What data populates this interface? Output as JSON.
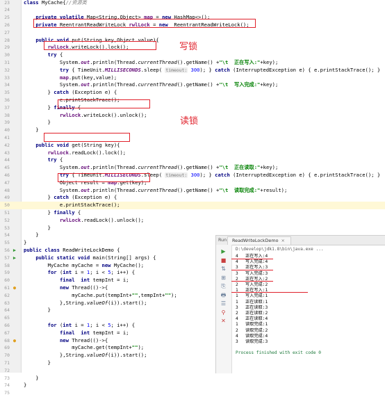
{
  "lines": [
    {
      "n": "23",
      "marker": "",
      "tokens": [
        [
          "kw",
          "class "
        ],
        [
          "",
          "MyCache"
        ],
        [
          "",
          "{"
        ],
        [
          "cmt",
          "//资源类"
        ]
      ]
    },
    {
      "n": "24",
      "marker": "",
      "tokens": []
    },
    {
      "n": "25",
      "marker": "",
      "tokens": [
        [
          "",
          "    "
        ],
        [
          "kw",
          "private volatile "
        ],
        [
          "",
          "Map<String,Object> "
        ],
        [
          "fld",
          "map"
        ],
        [
          "",
          " = "
        ],
        [
          "kw",
          "new "
        ],
        [
          "",
          "HashMap<>();"
        ]
      ]
    },
    {
      "n": "26",
      "marker": "",
      "tokens": [
        [
          "",
          "    "
        ],
        [
          "kw",
          "private "
        ],
        [
          "",
          "ReentrantReadWriteLock "
        ],
        [
          "fld",
          "rwlLock"
        ],
        [
          "",
          " = "
        ],
        [
          "kw",
          "new  "
        ],
        [
          "",
          "ReentrantReadWriteLock();"
        ]
      ]
    },
    {
      "n": "27",
      "marker": "",
      "tokens": []
    },
    {
      "n": "28",
      "marker": "",
      "tokens": [
        [
          "",
          "    "
        ],
        [
          "kw",
          "public void "
        ],
        [
          "",
          "put(String key,Object value){"
        ]
      ]
    },
    {
      "n": "29",
      "marker": "",
      "tokens": [
        [
          "",
          "        "
        ],
        [
          "fld",
          "rwlLock"
        ],
        [
          "",
          ".writeLock().lock();"
        ]
      ]
    },
    {
      "n": "30",
      "marker": "",
      "tokens": [
        [
          "",
          "        "
        ],
        [
          "kw",
          "try "
        ],
        [
          "",
          "{"
        ]
      ]
    },
    {
      "n": "31",
      "marker": "",
      "tokens": [
        [
          "",
          "            System."
        ],
        [
          "sfld",
          "out"
        ],
        [
          "",
          ".println(Thread."
        ],
        [
          "ital",
          "currentThread"
        ],
        [
          "",
          "().getName() +"
        ],
        [
          "str",
          "\"\\t  正在写入:\""
        ],
        [
          "",
          "+key);"
        ]
      ]
    },
    {
      "n": "32",
      "marker": "",
      "tokens": [
        [
          "",
          "            "
        ],
        [
          "kw",
          "try "
        ],
        [
          "",
          "{ TimeUnit."
        ],
        [
          "sfld",
          "MILLISECONDS"
        ],
        [
          "",
          ".sleep( "
        ],
        [
          "hint",
          "timeout:"
        ],
        [
          "num",
          " 300"
        ],
        [
          "",
          "); } "
        ],
        [
          "kw",
          "catch "
        ],
        [
          "",
          "(InterruptedException e) { e.printStackTrace(); }"
        ]
      ]
    },
    {
      "n": "33",
      "marker": "",
      "tokens": [
        [
          "",
          "            "
        ],
        [
          "fld",
          "map"
        ],
        [
          "",
          ".put(key,value);"
        ]
      ]
    },
    {
      "n": "34",
      "marker": "",
      "tokens": [
        [
          "",
          "            System."
        ],
        [
          "sfld",
          "out"
        ],
        [
          "",
          ".println(Thread."
        ],
        [
          "ital",
          "currentThread"
        ],
        [
          "",
          "().getName() +"
        ],
        [
          "str",
          "\"\\t  写入完成:\""
        ],
        [
          "",
          "+key);"
        ]
      ]
    },
    {
      "n": "35",
      "marker": "",
      "tokens": [
        [
          "",
          "        } "
        ],
        [
          "kw",
          "catch "
        ],
        [
          "",
          "(Exception e) {"
        ]
      ]
    },
    {
      "n": "36",
      "marker": "",
      "tokens": [
        [
          "",
          "            e.printStackTrace();"
        ]
      ]
    },
    {
      "n": "37",
      "marker": "",
      "tokens": [
        [
          "",
          "        } "
        ],
        [
          "kw",
          "finally "
        ],
        [
          "",
          "{"
        ]
      ]
    },
    {
      "n": "38",
      "marker": "",
      "tokens": [
        [
          "",
          "            "
        ],
        [
          "fld",
          "rwlLock"
        ],
        [
          "",
          ".writeLock().unlock();"
        ]
      ]
    },
    {
      "n": "39",
      "marker": "",
      "tokens": [
        [
          "",
          "        }"
        ]
      ]
    },
    {
      "n": "40",
      "marker": "",
      "tokens": [
        [
          "",
          "    }"
        ]
      ]
    },
    {
      "n": "41",
      "marker": "",
      "tokens": []
    },
    {
      "n": "42",
      "marker": "",
      "tokens": [
        [
          "",
          "    "
        ],
        [
          "kw",
          "public void "
        ],
        [
          "",
          "get(String key){"
        ]
      ]
    },
    {
      "n": "43",
      "marker": "",
      "tokens": [
        [
          "",
          "        "
        ],
        [
          "fld",
          "rwlLock"
        ],
        [
          "",
          ".readLock().lock();"
        ]
      ]
    },
    {
      "n": "44",
      "marker": "",
      "tokens": [
        [
          "",
          "        "
        ],
        [
          "kw",
          "try "
        ],
        [
          "",
          "{"
        ]
      ]
    },
    {
      "n": "45",
      "marker": "",
      "tokens": [
        [
          "",
          "            System."
        ],
        [
          "sfld",
          "out"
        ],
        [
          "",
          ".println(Thread."
        ],
        [
          "ital",
          "currentThread"
        ],
        [
          "",
          "().getName() +"
        ],
        [
          "str",
          "\"\\t  正在读取:\""
        ],
        [
          "",
          "+key);"
        ]
      ]
    },
    {
      "n": "46",
      "marker": "",
      "tokens": [
        [
          "",
          "            "
        ],
        [
          "kw",
          "try "
        ],
        [
          "",
          "{ TimeUnit."
        ],
        [
          "sfld",
          "MILLISECONDS"
        ],
        [
          "",
          ".sleep( "
        ],
        [
          "hint",
          "timeout:"
        ],
        [
          "num",
          " 300"
        ],
        [
          "",
          "); } "
        ],
        [
          "kw",
          "catch "
        ],
        [
          "",
          "(InterruptedException e) { e.printStackTrace(); }"
        ]
      ]
    },
    {
      "n": "47",
      "marker": "",
      "tokens": [
        [
          "",
          "            Object result = "
        ],
        [
          "fld",
          "map"
        ],
        [
          "",
          ".get(key);"
        ]
      ]
    },
    {
      "n": "48",
      "marker": "",
      "tokens": [
        [
          "",
          "            System."
        ],
        [
          "sfld",
          "out"
        ],
        [
          "",
          ".println(Thread."
        ],
        [
          "ital",
          "currentThread"
        ],
        [
          "",
          "().getName() +"
        ],
        [
          "str",
          "\"\\t  读取完成:\""
        ],
        [
          "",
          "+result);"
        ]
      ]
    },
    {
      "n": "49",
      "marker": "",
      "tokens": [
        [
          "",
          "        } "
        ],
        [
          "kw",
          "catch "
        ],
        [
          "",
          "(Exception e) {"
        ]
      ]
    },
    {
      "n": "50",
      "marker": "",
      "highlight": true,
      "tokens": [
        [
          "",
          "            e.printStackTrace();"
        ]
      ]
    },
    {
      "n": "51",
      "marker": "",
      "tokens": [
        [
          "",
          "        } "
        ],
        [
          "kw",
          "finally "
        ],
        [
          "",
          "{"
        ]
      ]
    },
    {
      "n": "52",
      "marker": "",
      "tokens": [
        [
          "",
          "            "
        ],
        [
          "fld",
          "rwlLock"
        ],
        [
          "",
          ".readLock().unlock();"
        ]
      ]
    },
    {
      "n": "53",
      "marker": "",
      "tokens": [
        [
          "",
          "        }"
        ]
      ]
    },
    {
      "n": "54",
      "marker": "",
      "tokens": [
        [
          "",
          "    }"
        ]
      ]
    },
    {
      "n": "55",
      "marker": "",
      "tokens": [
        [
          "",
          "}"
        ]
      ]
    },
    {
      "n": "56",
      "marker": "▶",
      "tokens": [
        [
          "kw",
          "public class "
        ],
        [
          "",
          "ReadWriteLockDemo {"
        ]
      ]
    },
    {
      "n": "57",
      "marker": "▶",
      "tokens": [
        [
          "",
          "    "
        ],
        [
          "kw",
          "public static void "
        ],
        [
          "",
          "main(String[] args) {"
        ]
      ]
    },
    {
      "n": "58",
      "marker": "",
      "tokens": [
        [
          "",
          "        MyCache myCache = "
        ],
        [
          "kw",
          "new "
        ],
        [
          "",
          "MyCache();"
        ]
      ]
    },
    {
      "n": "59",
      "marker": "",
      "tokens": [
        [
          "",
          "        "
        ],
        [
          "kw",
          "for "
        ],
        [
          "",
          "("
        ],
        [
          "kw",
          "int "
        ],
        [
          "",
          "i = "
        ],
        [
          "num",
          "1"
        ],
        [
          "",
          "; i < "
        ],
        [
          "num",
          "5"
        ],
        [
          "",
          "; i++) {"
        ]
      ]
    },
    {
      "n": "60",
      "marker": "",
      "tokens": [
        [
          "",
          "            "
        ],
        [
          "kw",
          "final  int "
        ],
        [
          "",
          "tempInt = i;"
        ]
      ]
    },
    {
      "n": "61",
      "marker": "●",
      "tokens": [
        [
          "",
          "            "
        ],
        [
          "kw",
          "new "
        ],
        [
          "",
          "Thread(()->{"
        ]
      ]
    },
    {
      "n": "62",
      "marker": "",
      "tokens": [
        [
          "",
          "                myCache.put(tempInt+"
        ],
        [
          "str",
          "\"\""
        ],
        [
          "",
          ",tempInt+"
        ],
        [
          "str",
          "\"\""
        ],
        [
          "",
          ");"
        ]
      ]
    },
    {
      "n": "63",
      "marker": "",
      "tokens": [
        [
          "",
          "            },String."
        ],
        [
          "ital",
          "valueOf"
        ],
        [
          "",
          "(i)).start();"
        ]
      ]
    },
    {
      "n": "64",
      "marker": "",
      "tokens": [
        [
          "",
          "        }"
        ]
      ]
    },
    {
      "n": "65",
      "marker": "",
      "tokens": []
    },
    {
      "n": "66",
      "marker": "",
      "tokens": [
        [
          "",
          "        "
        ],
        [
          "kw",
          "for "
        ],
        [
          "",
          "("
        ],
        [
          "kw",
          "int "
        ],
        [
          "",
          "i = "
        ],
        [
          "num",
          "1"
        ],
        [
          "",
          "; i < "
        ],
        [
          "num",
          "5"
        ],
        [
          "",
          "; i++) {"
        ]
      ]
    },
    {
      "n": "67",
      "marker": "",
      "tokens": [
        [
          "",
          "            "
        ],
        [
          "kw",
          "final  int "
        ],
        [
          "",
          "tempInt = i;"
        ]
      ]
    },
    {
      "n": "68",
      "marker": "●",
      "tokens": [
        [
          "",
          "            "
        ],
        [
          "kw",
          "new "
        ],
        [
          "",
          "Thread(()->{"
        ]
      ]
    },
    {
      "n": "69",
      "marker": "",
      "tokens": [
        [
          "",
          "                myCache.get(tempInt+"
        ],
        [
          "str",
          "\"\""
        ],
        [
          "",
          ");"
        ]
      ]
    },
    {
      "n": "70",
      "marker": "",
      "tokens": [
        [
          "",
          "            },String."
        ],
        [
          "ital",
          "valueOf"
        ],
        [
          "",
          "(i)).start();"
        ]
      ]
    },
    {
      "n": "71",
      "marker": "",
      "tokens": [
        [
          "",
          "        }"
        ]
      ]
    },
    {
      "n": "72",
      "marker": "",
      "tokens": []
    },
    {
      "n": "73",
      "marker": "",
      "tokens": [
        [
          "",
          "    }"
        ]
      ]
    },
    {
      "n": "74",
      "marker": "",
      "tokens": [
        [
          "",
          "}"
        ]
      ]
    },
    {
      "n": "75",
      "marker": "",
      "tokens": []
    }
  ],
  "annotations": {
    "write_lock": "写锁",
    "read_lock": "读锁"
  },
  "run": {
    "label": "Run",
    "tab": "ReadWriteLockDemo",
    "tab_close": "×",
    "path": "D:\\develop\\jdk1.8\\bin\\java.exe ...",
    "output": [
      [
        "4",
        "正在写入:4"
      ],
      [
        "4",
        "写入完成:4"
      ],
      [
        "3",
        "正在写入:3"
      ],
      [
        "3",
        "写入完成:3"
      ],
      [
        "2",
        "正在写入:2"
      ],
      [
        "2",
        "写入完成:2"
      ],
      [
        "1",
        "正在写入:1"
      ],
      [
        "1",
        "写入完成:1"
      ],
      [
        "1",
        "正在读取:1"
      ],
      [
        "3",
        "正在读取:3"
      ],
      [
        "2",
        "正在读取:2"
      ],
      [
        "4",
        "正在读取:4"
      ],
      [
        "1",
        "读取完成:1"
      ],
      [
        "2",
        "读取完成:2"
      ],
      [
        "4",
        "读取完成:4"
      ],
      [
        "3",
        "读取完成:3"
      ]
    ],
    "finished": "Process finished with exit code 0",
    "tools": [
      {
        "icon": "▶",
        "name": "rerun-icon",
        "color": "#3a9a3a"
      },
      {
        "icon": "■",
        "name": "stop-icon",
        "color": "#c94040"
      },
      {
        "icon": "⇅",
        "name": "scroll-icon",
        "color": "#6a7f9a"
      },
      {
        "icon": "⊞",
        "name": "layout-icon",
        "color": "#6a7f9a"
      },
      {
        "icon": "⎘",
        "name": "copy-icon",
        "color": "#6a7f9a"
      },
      {
        "icon": "🖶",
        "name": "print-icon",
        "color": "#6a7f9a"
      },
      {
        "icon": "☰",
        "name": "settings-icon",
        "color": "#6a7f9a"
      },
      {
        "icon": "⚲",
        "name": "pin-icon",
        "color": "#c94040"
      },
      {
        "icon": "✕",
        "name": "close-icon",
        "color": "#c94040"
      }
    ]
  },
  "colors": {
    "annotation_red": "#e0202a",
    "keyword": "#000080",
    "string": "#008000",
    "field": "#660e7a"
  }
}
